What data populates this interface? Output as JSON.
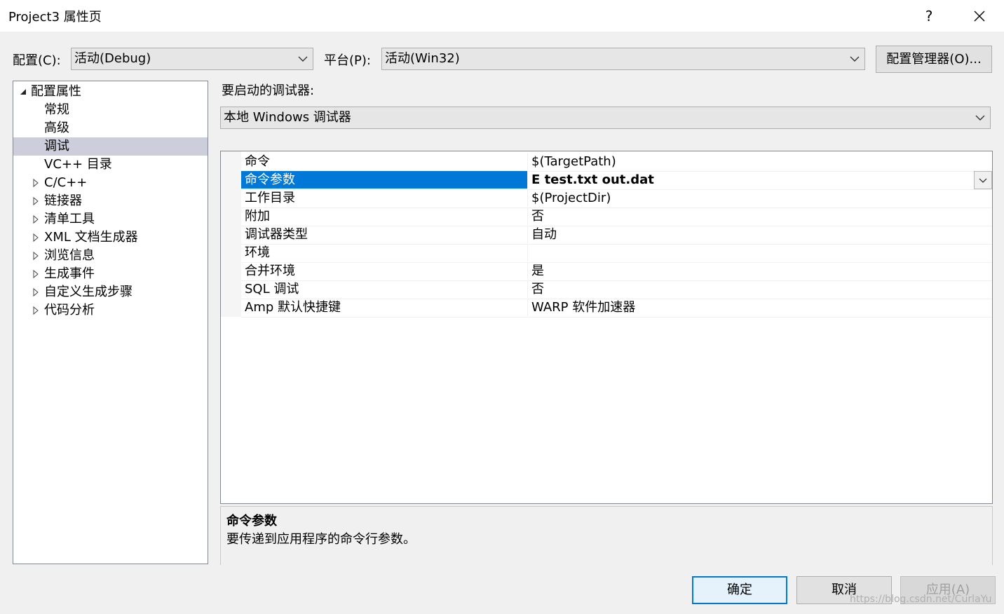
{
  "window": {
    "title": "Project3 属性页",
    "help": "?"
  },
  "config": {
    "label": "配置(C):",
    "value": "活动(Debug)"
  },
  "platform": {
    "label": "平台(P):",
    "value": "活动(Win32)"
  },
  "config_manager_label": "配置管理器(O)...",
  "debugger": {
    "label": "要启动的调试器:",
    "value": "本地 Windows 调试器"
  },
  "tree": {
    "root": "配置属性",
    "items": [
      "常规",
      "高级",
      "调试",
      "VC++ 目录",
      "C/C++",
      "链接器",
      "清单工具",
      "XML 文档生成器",
      "浏览信息",
      "生成事件",
      "自定义生成步骤",
      "代码分析"
    ],
    "selected": "调试"
  },
  "grid": {
    "rows": [
      {
        "name": "命令",
        "value": "$(TargetPath)"
      },
      {
        "name": "命令参数",
        "value": "E test.txt out.dat"
      },
      {
        "name": "工作目录",
        "value": "$(ProjectDir)"
      },
      {
        "name": "附加",
        "value": "否"
      },
      {
        "name": "调试器类型",
        "value": "自动"
      },
      {
        "name": "环境",
        "value": ""
      },
      {
        "name": "合并环境",
        "value": "是"
      },
      {
        "name": "SQL 调试",
        "value": "否"
      },
      {
        "name": "Amp 默认快捷键",
        "value": "WARP 软件加速器"
      }
    ],
    "selected": "命令参数"
  },
  "description": {
    "title": "命令参数",
    "text": "要传递到应用程序的命令行参数。"
  },
  "buttons": {
    "ok": "确定",
    "cancel": "取消",
    "apply": "应用(A)"
  },
  "watermark": "https://blog.csdn.net/CurlaYu",
  "colors": {
    "selection_blue": "#0078d7",
    "tree_selection": "#cccedb",
    "background": "#f0f0f0"
  }
}
